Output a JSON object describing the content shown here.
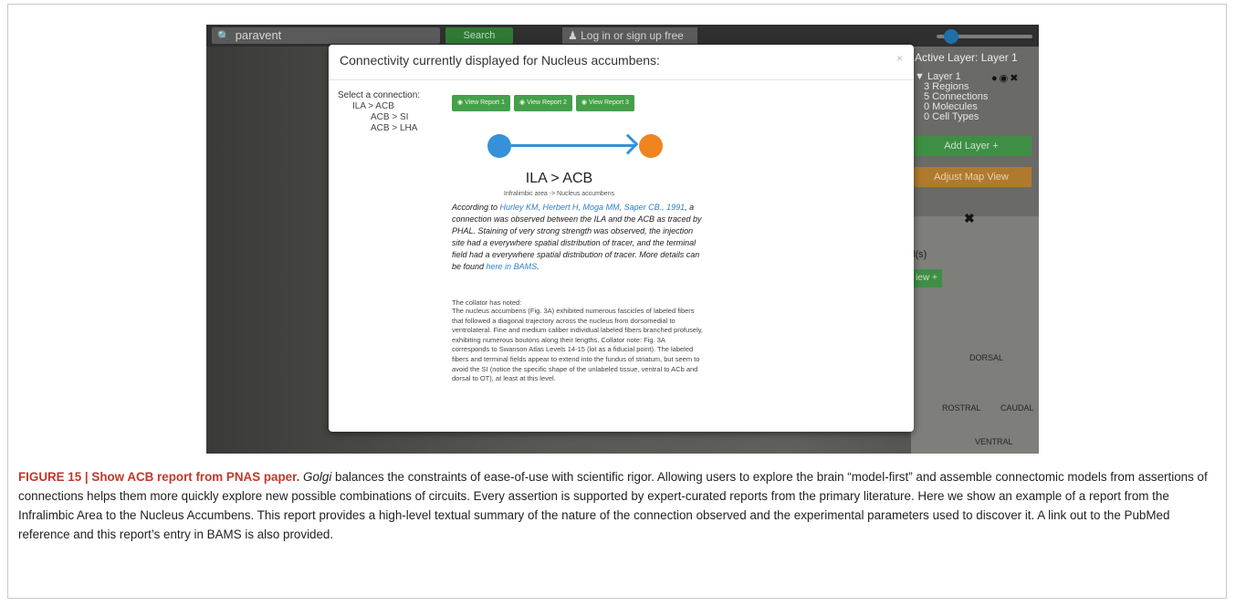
{
  "screenshot": {
    "topbar": {
      "search_value": "paravent",
      "search_button": "Search",
      "login_button": "Log in or sign up free"
    },
    "right_panel": {
      "title": "Active Layer: Layer 1",
      "layer_name": "Layer 1",
      "regions": "3 Regions",
      "connections": "5 Connections",
      "molecules": "0 Molecules",
      "cell_types": "0 Cell Types",
      "add_layer": "Add Layer +",
      "adjust_map": "Adjust Map View"
    },
    "map": {
      "partial_text": "l(s)",
      "partial_button": "iew +",
      "dorsal": "DORSAL",
      "rostral": "ROSTRAL",
      "caudal": "CAUDAL",
      "ventral": "VENTRAL"
    },
    "modal": {
      "title": "Connectivity currently displayed for Nucleus accumbens:",
      "close": "×",
      "select_label": "Select a connection:",
      "connections": [
        "ILA > ACB",
        "ACB > SI",
        "ACB > LHA"
      ],
      "report_buttons": [
        "View Report 1",
        "View Report 2",
        "View Report 3"
      ],
      "connection_title": "ILA > ACB",
      "connection_subtitle": "Infralimbic area -> Nucleus accumbens",
      "summary_prefix": "According to ",
      "summary_citation": "Hurley KM, Herbert H, Moga MM, Saper CB., 1991",
      "summary_middle": ", a connection was observed between the ILA and the ACB as traced by PHAL. Staining of very strong strength was observed, the injection site had a everywhere spatial distribution of tracer, and the terminal field had a everywhere spatial distribution of tracer. More details can be found ",
      "summary_link": "here in BAMS",
      "summary_end": ".",
      "notes_heading": "The collator has noted:",
      "notes_body": "The nucleus accumbens (Fig. 3A) exhibited numerous fascicles of labeled fibers that followed a diagonal trajectory across the nucleus from dorsomedial to ventrolateral. Fine and medium caliber individual labeled fibers branched profusely, exhibiting numerous boutons along their lengths. Collator note: Fig. 3A corresponds to Swanson Atlas Levels 14-15 (lot as a fiducial point). The labeled fibers and terminal fields appear to extend into the fundus of striatum, but seem to avoid the SI (notice the specific shape of the unlabeled tissue, ventral to ACb and dorsal to OT), at least at this level."
    }
  },
  "caption": {
    "lead": "FIGURE 15 | Show ACB report from PNAS paper.",
    "golgi": "Golgi",
    "text": " balances the constraints of ease-of-use with scientific rigor. Allowing users to explore the brain “model-first” and assemble connectomic models from assertions of connections helps them more quickly explore new possible combinations of circuits. Every assertion is supported by expert-curated reports from the primary literature. Here we show an example of a report from the Infralimbic Area to the Nucleus Accumbens. This report provides a high-level textual summary of the nature of the connection observed and the experimental parameters used to discover it. A link out to the PubMed reference and this report’s entry in BAMS is also provided."
  },
  "colors": {
    "caption_lead": "#c0392b",
    "source_node": "#3591d8",
    "target_node": "#f08420",
    "button_green": "#44a049",
    "link_blue": "#2f7fc8"
  }
}
